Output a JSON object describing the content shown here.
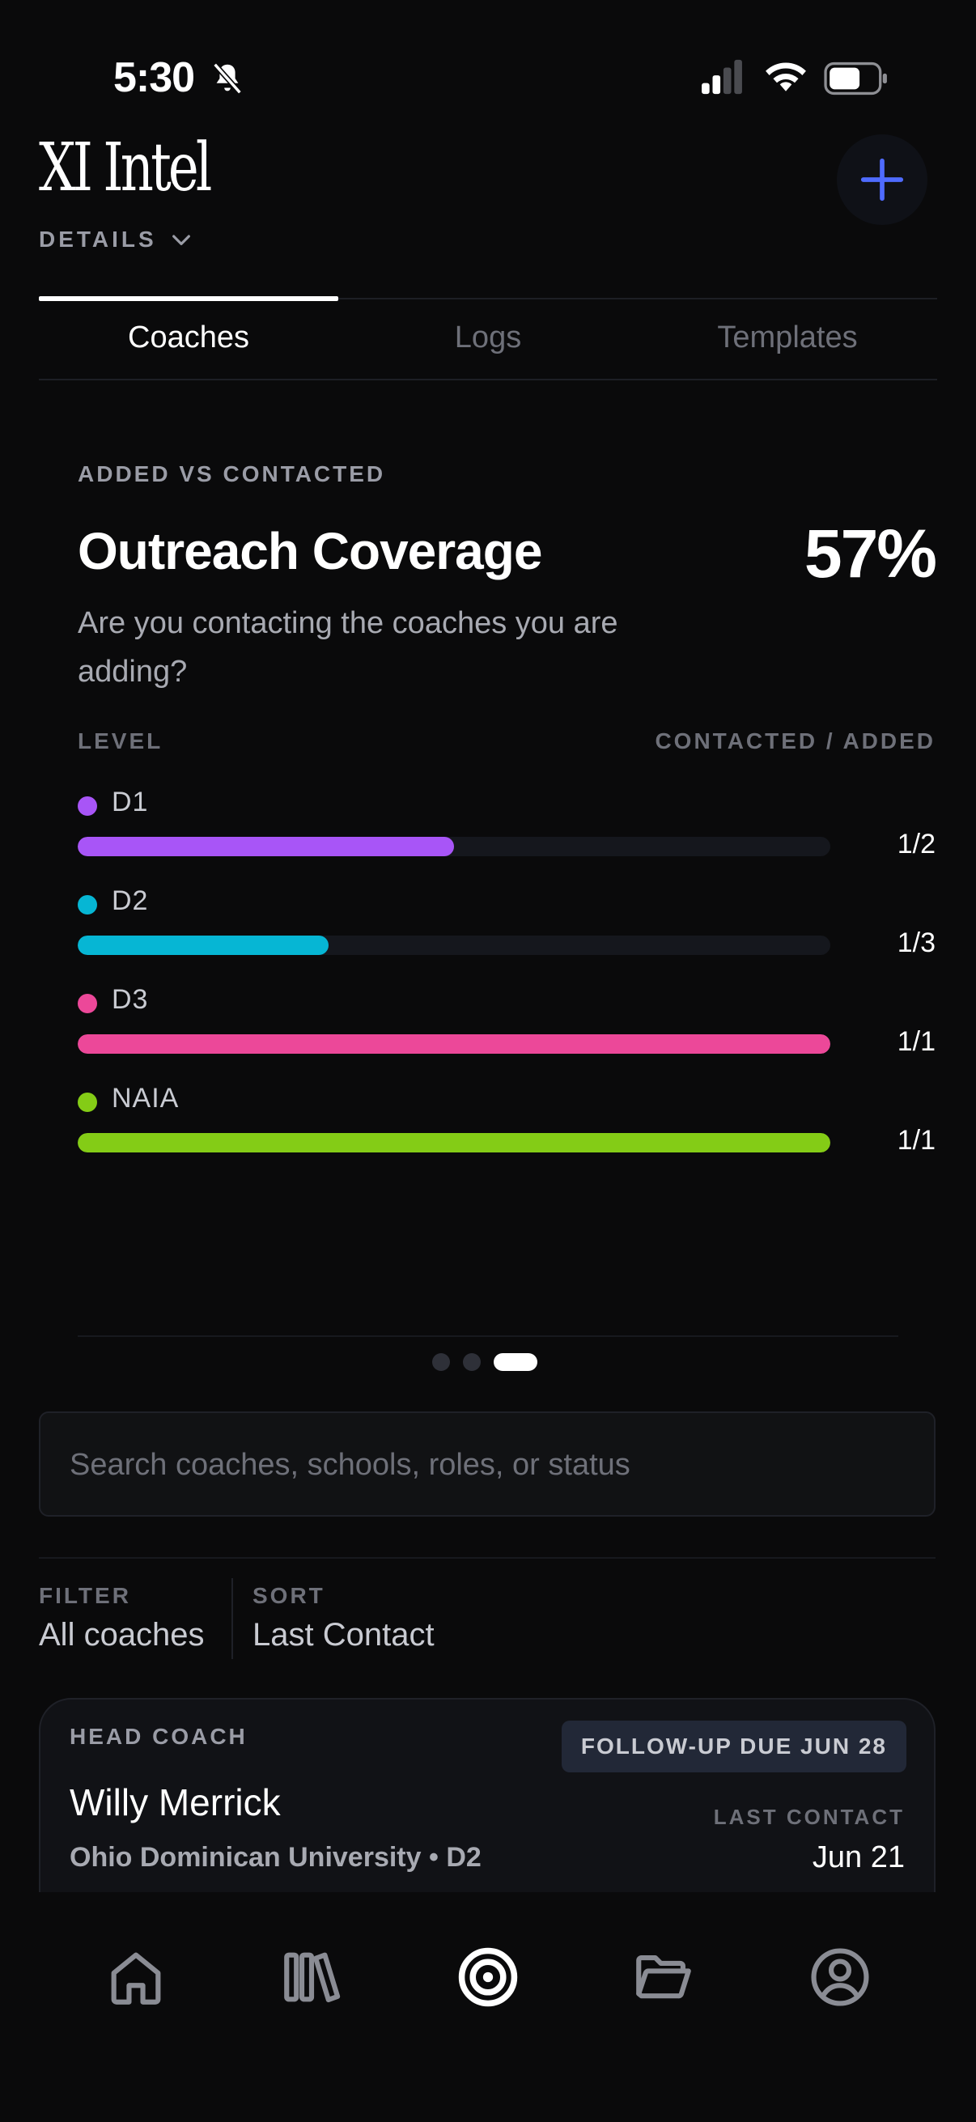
{
  "status_bar": {
    "time": "5:30"
  },
  "header": {
    "title": "XI Intel",
    "details_label": "DETAILS"
  },
  "tabs": [
    {
      "label": "Coaches",
      "active": true
    },
    {
      "label": "Logs",
      "active": false
    },
    {
      "label": "Templates",
      "active": false
    }
  ],
  "coverage": {
    "eyebrow": "ADDED VS CONTACTED",
    "title": "Outreach Coverage",
    "percent": "57%",
    "subtitle": "Are you contacting the coaches you are adding?",
    "col_level": "LEVEL",
    "col_ratio": "CONTACTED / ADDED",
    "levels": [
      {
        "name": "D1",
        "ratio": "1/2",
        "fraction": 0.5,
        "color": "#a855f7"
      },
      {
        "name": "D2",
        "ratio": "1/3",
        "fraction": 0.333,
        "color": "#06b6d4"
      },
      {
        "name": "D3",
        "ratio": "1/1",
        "fraction": 1.0,
        "color": "#ec4899"
      },
      {
        "name": "NAIA",
        "ratio": "1/1",
        "fraction": 1.0,
        "color": "#84cc16"
      }
    ],
    "pager": {
      "count": 3,
      "active": 2
    }
  },
  "search": {
    "placeholder": "Search coaches, schools, roles, or status",
    "value": ""
  },
  "filter": {
    "label": "FILTER",
    "value": "All coaches"
  },
  "sort": {
    "label": "SORT",
    "value": "Last Contact"
  },
  "coach_card": {
    "role": "HEAD COACH",
    "badge": "FOLLOW-UP DUE JUN 28",
    "name": "Willy Merrick",
    "school": "Ohio Dominican University • D2",
    "last_contact_label": "LAST CONTACT",
    "last_contact_value": "Jun 21"
  },
  "bottom_nav": {
    "items": [
      "home-icon",
      "library-icon",
      "target-icon",
      "folder-icon",
      "profile-icon"
    ],
    "active": "target-icon"
  },
  "colors": {
    "accent": "#4f6bff",
    "background": "#0a0a0b"
  }
}
